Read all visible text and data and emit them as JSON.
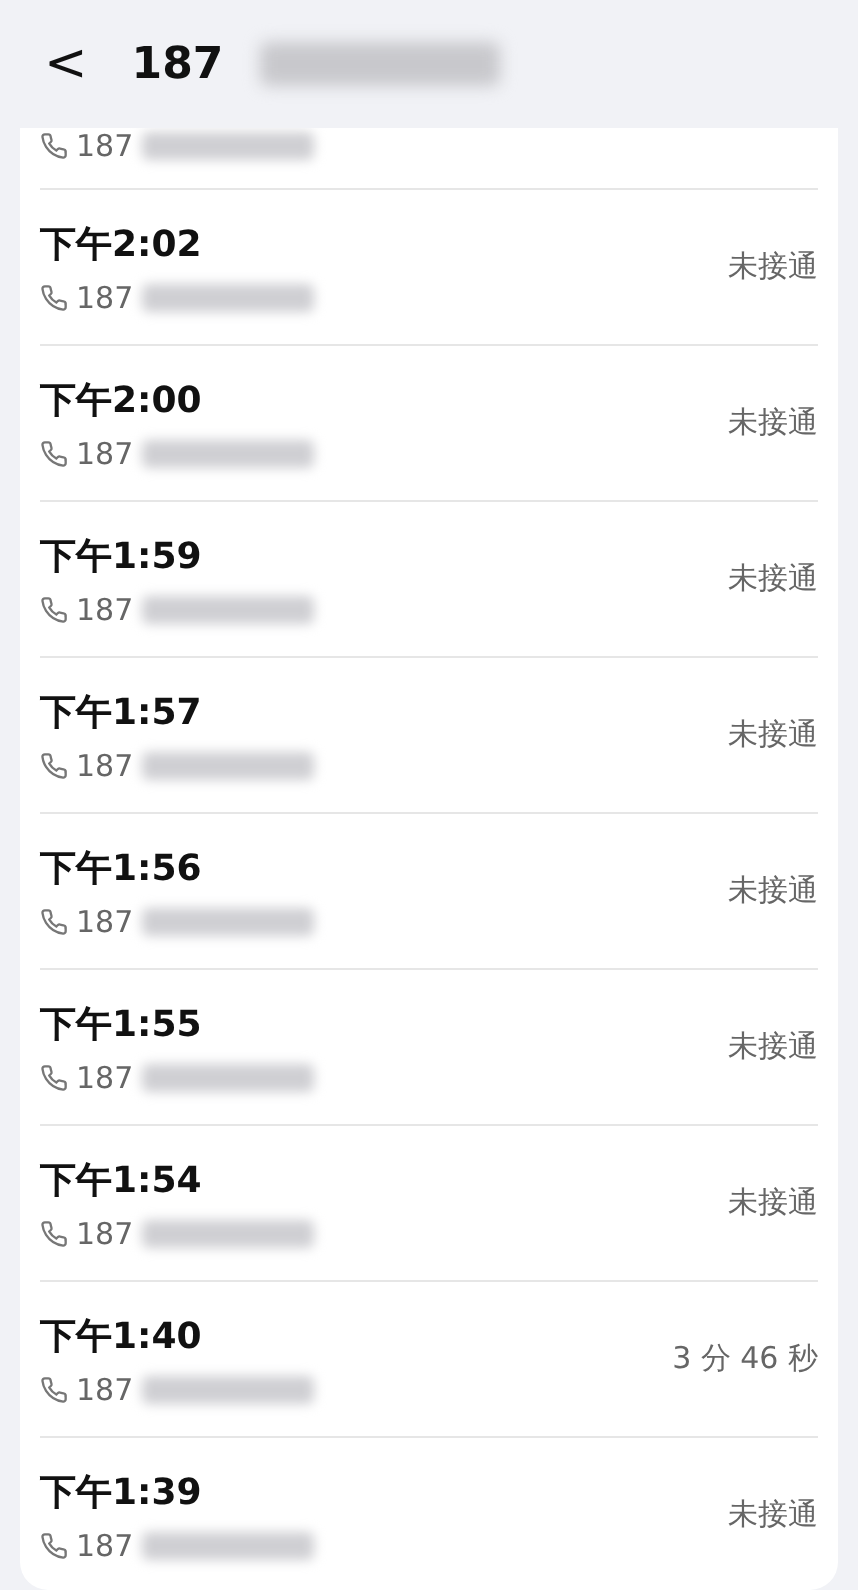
{
  "header": {
    "back": "<",
    "title": "187"
  },
  "partial_call": {
    "number": "187"
  },
  "calls": [
    {
      "time": "下午2:02",
      "number": "187",
      "status": "未接通"
    },
    {
      "time": "下午2:00",
      "number": "187",
      "status": "未接通"
    },
    {
      "time": "下午1:59",
      "number": "187",
      "status": "未接通"
    },
    {
      "time": "下午1:57",
      "number": "187",
      "status": "未接通"
    },
    {
      "time": "下午1:56",
      "number": "187",
      "status": "未接通"
    },
    {
      "time": "下午1:55",
      "number": "187",
      "status": "未接通"
    },
    {
      "time": "下午1:54",
      "number": "187",
      "status": "未接通"
    },
    {
      "time": "下午1:40",
      "number": "187",
      "status": "3 分 46 秒"
    },
    {
      "time": "下午1:39",
      "number": "187",
      "status": "未接通"
    }
  ]
}
